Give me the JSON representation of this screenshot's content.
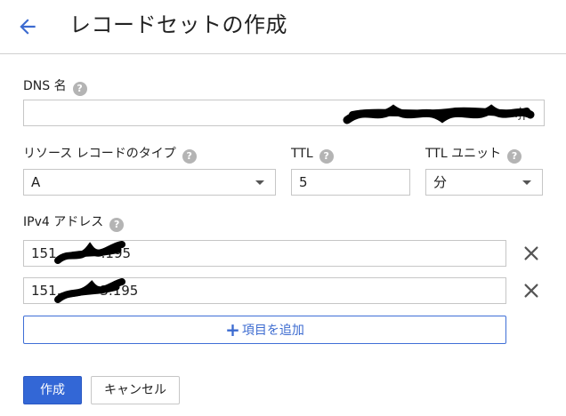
{
  "header": {
    "title": "レコードセットの作成",
    "back_icon": "arrow-left-icon"
  },
  "dns": {
    "label": "DNS 名",
    "value": "",
    "suffix": ".jp."
  },
  "record_type": {
    "label": "リソース レコードのタイプ",
    "value": "A"
  },
  "ttl": {
    "label": "TTL",
    "value": "5"
  },
  "ttl_unit": {
    "label": "TTL ユニット",
    "value": "分"
  },
  "ipv4": {
    "label": "IPv4 アドレス",
    "addresses": [
      {
        "left": "151",
        "right": ".195"
      },
      {
        "left": "151.",
        "right": "3.195"
      }
    ]
  },
  "buttons": {
    "add": "項目を追加",
    "create": "作成",
    "cancel": "キャンセル"
  },
  "colors": {
    "accent": "#3367d6",
    "help": "#b4b4b4"
  }
}
